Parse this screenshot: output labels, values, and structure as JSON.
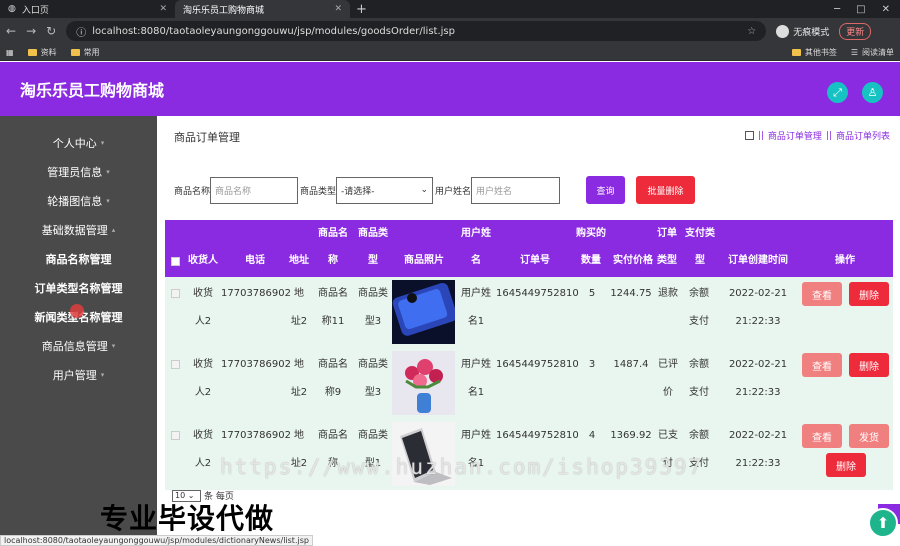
{
  "browser": {
    "tabs": [
      {
        "label": "入口页"
      },
      {
        "label": "淘乐乐员工购物商城"
      }
    ],
    "url": "localhost:8080/taotaoleyaungonggouwu/jsp/modules/goodsOrder/list.jsp",
    "guest_label": "无痕模式",
    "update_label": "更新",
    "bookmarks": [
      "资料",
      "常用"
    ],
    "bookmarks_right": [
      "其他书签",
      "阅读清单"
    ]
  },
  "app": {
    "title": "淘乐乐员工购物商城"
  },
  "sidebar": {
    "items": [
      {
        "label": "个人中心"
      },
      {
        "label": "管理员信息"
      },
      {
        "label": "轮播图信息"
      },
      {
        "label": "基础数据管理"
      },
      {
        "label": "商品名称管理"
      },
      {
        "label": "订单类型名称管理"
      },
      {
        "label": "新闻类型名称管理"
      },
      {
        "label": "商品信息管理"
      },
      {
        "label": "用户管理"
      }
    ]
  },
  "main": {
    "page_title": "商品订单管理",
    "breadcrumb": [
      "商品订单管理",
      "商品订单列表"
    ],
    "filters": {
      "goods_name_label": "商品名称",
      "goods_name_placeholder": "商品名称",
      "goods_type_label": "商品类型",
      "goods_type_value": "-请选择-",
      "user_name_label": "用户姓名",
      "user_name_placeholder": "用户姓名",
      "search_label": "查询",
      "batch_delete_label": "批量删除"
    },
    "table": {
      "headers": {
        "receiver": "收货人",
        "phone": "电话",
        "address": "地址",
        "goods_name": [
          "商品名",
          "称"
        ],
        "goods_type": [
          "商品类",
          "型"
        ],
        "photo": "商品照片",
        "user_name": [
          "用户姓",
          "名"
        ],
        "order_no": "订单号",
        "qty": [
          "购买的",
          "数量"
        ],
        "price": "实付价格",
        "order_type": [
          "订单",
          "类型"
        ],
        "pay_type": [
          "支付类",
          "型"
        ],
        "created": "订单创建时间",
        "actions": "操作"
      },
      "rows": [
        {
          "receiver": [
            "收货",
            "人2"
          ],
          "phone": "17703786902",
          "address": [
            "地",
            "址2"
          ],
          "goods_name": [
            "商品名",
            "称11"
          ],
          "goods_type": [
            "商品类",
            "型3"
          ],
          "photo": "phone",
          "user_name": [
            "用户姓",
            "名1"
          ],
          "order_no": "1645449752810",
          "qty": "5",
          "price": "1244.75",
          "order_type": [
            "退款"
          ],
          "pay_type": [
            "余额",
            "支付"
          ],
          "created": [
            "2022-02-21",
            "21:22:33"
          ],
          "actions": [
            "查看",
            "删除"
          ]
        },
        {
          "receiver": [
            "收货",
            "人2"
          ],
          "phone": "17703786902",
          "address": [
            "地",
            "址2"
          ],
          "goods_name": [
            "商品名",
            "称9"
          ],
          "goods_type": [
            "商品类",
            "型3"
          ],
          "photo": "flowers",
          "user_name": [
            "用户姓",
            "名1"
          ],
          "order_no": "1645449752810",
          "qty": "3",
          "price": "1487.4",
          "order_type": [
            "已评",
            "价"
          ],
          "pay_type": [
            "余额",
            "支付"
          ],
          "created": [
            "2022-02-21",
            "21:22:33"
          ],
          "actions": [
            "查看",
            "删除"
          ]
        },
        {
          "receiver": [
            "收货",
            "人2"
          ],
          "phone": "17703786902",
          "address": [
            "地",
            "址2"
          ],
          "goods_name": [
            "商品名",
            "称"
          ],
          "goods_type": [
            "商品类",
            "型1"
          ],
          "photo": "laptop",
          "user_name": [
            "用户姓",
            "名1"
          ],
          "order_no": "1645449752810",
          "qty": "4",
          "price": "1369.92",
          "order_type": [
            "已支",
            "付"
          ],
          "pay_type": [
            "余额",
            "支付"
          ],
          "created": [
            "2022-02-21",
            "21:22:33"
          ],
          "actions": [
            "查看",
            "发货",
            "删除"
          ]
        }
      ]
    },
    "pager": {
      "page_size": "10",
      "suffix": "条 每页"
    }
  },
  "overlay": {
    "watermark": "https://www.huzhan.com/ishop39397",
    "caption": "专业毕设代做"
  },
  "status_url": "localhost:8080/taotaoleyaungonggouwu/jsp/modules/dictionaryNews/list.jsp",
  "colors": {
    "brand": "#8a2be2",
    "accent": "#17c2c2",
    "row_bg": "#e9f6ef",
    "danger": "#ee2b3b",
    "soft_danger": "#f08080"
  }
}
